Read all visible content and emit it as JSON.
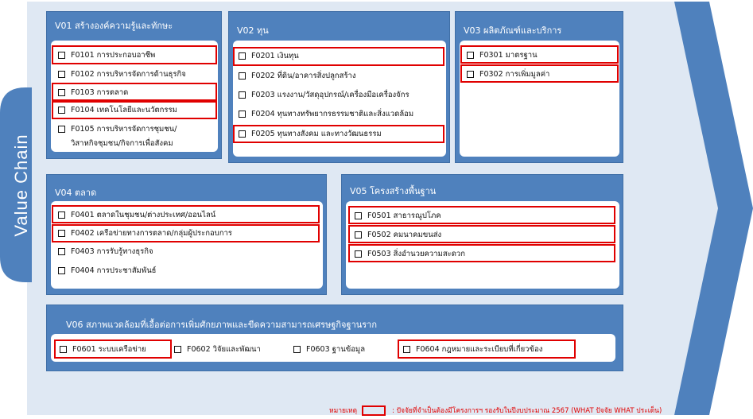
{
  "side_label": "Value Chain",
  "colors": {
    "panel": "#4f81bd",
    "arrow": "#dfe8f3",
    "chevron": "#4f81bd",
    "highlight": "#e00000"
  },
  "panels": [
    {
      "title": "V01 สร้างองค์ความรู้และทักษะ",
      "items": [
        {
          "label": "F0101 การประกอบอาชีพ",
          "highlighted": true
        },
        {
          "label": "F0102 การบริหารจัดการด้านธุรกิจ",
          "highlighted": false
        },
        {
          "label": "F0103 การตลาด",
          "highlighted": true
        },
        {
          "label": "F0104 เทคโนโลยีและนวัตกรรม",
          "highlighted": true
        },
        {
          "label": "F0105 การบริหารจัดการชุมชน/",
          "label2": "วิสาหกิจชุมชน/กิจการเพื่อสังคม",
          "highlighted": false
        }
      ]
    },
    {
      "title": "V02 ทุน",
      "items": [
        {
          "label": "F0201 เงินทุน",
          "highlighted": true
        },
        {
          "label": "F0202 ที่ดิน/อาคารสิ่งปลูกสร้าง",
          "highlighted": false
        },
        {
          "label": "F0203 แรงงาน/วัสดุอุปกรณ์/เครื่องมือเครื่องจักร",
          "highlighted": false
        },
        {
          "label": "F0204 ทุนทางทรัพยากรธรรมชาติและสิ่งแวดล้อม",
          "highlighted": false
        },
        {
          "label": "F0205 ทุนทางสังคม และทางวัฒนธรรม",
          "highlighted": true
        }
      ]
    },
    {
      "title": "V03 ผลิตภัณฑ์และบริการ",
      "items": [
        {
          "label": "F0301 มาตรฐาน",
          "highlighted": true
        },
        {
          "label": "F0302 การเพิ่มมูลค่า",
          "highlighted": true
        }
      ]
    },
    {
      "title": "V04 ตลาด",
      "items": [
        {
          "label": "F0401 ตลาดในชุมชน/ต่างประเทศ/ออนไลน์",
          "highlighted": true
        },
        {
          "label": "F0402 เครือข่ายทางการตลาด/กลุ่มผู้ประกอบการ",
          "highlighted": true
        },
        {
          "label": "F0403 การรับรู้ทางธุรกิจ",
          "highlighted": false
        },
        {
          "label": "F0404 การประชาสัมพันธ์",
          "highlighted": false
        }
      ]
    },
    {
      "title": "V05 โครงสร้างพื้นฐาน",
      "items": [
        {
          "label": "F0501 สาธารณูปโภค",
          "highlighted": true
        },
        {
          "label": "F0502 คมนาคมขนส่ง",
          "highlighted": true
        },
        {
          "label": "F0503 สิ่งอำนวยความสะดวก",
          "highlighted": true
        }
      ]
    },
    {
      "title": "V06 สภาพแวดล้อมที่เอื้อต่อการเพิ่มศักยภาพและขีดความสามารถเศรษฐกิจฐานราก",
      "items": [
        {
          "label": "F0601 ระบบเครือข่าย",
          "highlighted": true
        },
        {
          "label": "F0602 วิจัยและพัฒนา",
          "highlighted": false
        },
        {
          "label": "F0603 ฐานข้อมูล",
          "highlighted": false
        },
        {
          "label": "F0604 กฎหมายและระเบียบที่เกี่ยวข้อง",
          "highlighted": true
        }
      ]
    }
  ],
  "legend": {
    "prefix": "หมายเหตุ",
    "text": ": ปัจจัยที่จำเป็นต้องมีโครงการฯ รองรับในปีงบประมาณ 2567 (WHAT ปัจจัย WHAT ประเด็น)"
  }
}
